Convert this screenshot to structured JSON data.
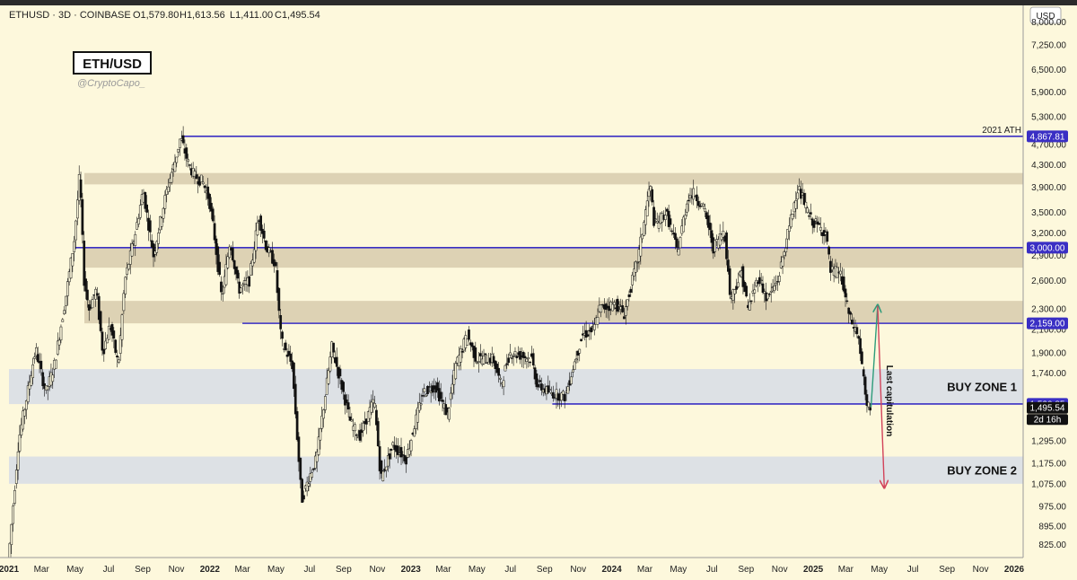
{
  "header": {
    "symbol_line": "ETHUSD · 3D · COINBASE",
    "open": "O1,579.80",
    "high": "H1,613.56",
    "low": "L1,411.00",
    "close": "C1,495.54"
  },
  "chart_title": "ETH/USD",
  "author_handle": "@CryptoCapo_",
  "currency_label": "USD",
  "colors": {
    "background": "#fdf8dc",
    "level_line": "#3a2fc4",
    "resistance_zone": "#ddd2b4",
    "buy_zone": "#dde1e5",
    "candle": "#111111",
    "up_arrow": "#2e9c7a",
    "down_arrow": "#d2435a",
    "price_tag_current": "#111111"
  },
  "chart_data": {
    "type": "candlestick",
    "y_scale": "log",
    "ylim": [
      780,
      8600
    ],
    "y_ticks": [
      "8,000.00",
      "7,250.00",
      "6,500.00",
      "5,900.00",
      "5,300.00",
      "4,700.00",
      "4,300.00",
      "3,900.00",
      "3,500.00",
      "3,200.00",
      "2,900.00",
      "2,600.00",
      "2,300.00",
      "2,100.00",
      "1,900.00",
      "1,740.00",
      "1,295.00",
      "1,175.00",
      "1,075.00",
      "975.00",
      "895.00",
      "825.00"
    ],
    "y_tick_values": [
      8000,
      7250,
      6500,
      5900,
      5300,
      4700,
      4300,
      3900,
      3500,
      3200,
      2900,
      2600,
      2300,
      2100,
      1900,
      1740,
      1295,
      1175,
      1075,
      975,
      895,
      825
    ],
    "x_ticks": [
      {
        "label": "2021",
        "date": "2021-01-01"
      },
      {
        "label": "Mar",
        "date": "2021-03-01"
      },
      {
        "label": "May",
        "date": "2021-05-01"
      },
      {
        "label": "Jul",
        "date": "2021-07-01"
      },
      {
        "label": "Sep",
        "date": "2021-09-01"
      },
      {
        "label": "Nov",
        "date": "2021-11-01"
      },
      {
        "label": "2022",
        "date": "2022-01-01"
      },
      {
        "label": "Mar",
        "date": "2022-03-01"
      },
      {
        "label": "May",
        "date": "2022-05-01"
      },
      {
        "label": "Jul",
        "date": "2022-07-01"
      },
      {
        "label": "Sep",
        "date": "2022-09-01"
      },
      {
        "label": "Nov",
        "date": "2022-11-01"
      },
      {
        "label": "2023",
        "date": "2023-01-01"
      },
      {
        "label": "Mar",
        "date": "2023-03-01"
      },
      {
        "label": "May",
        "date": "2023-05-01"
      },
      {
        "label": "Jul",
        "date": "2023-07-01"
      },
      {
        "label": "Sep",
        "date": "2023-09-01"
      },
      {
        "label": "Nov",
        "date": "2023-11-01"
      },
      {
        "label": "2024",
        "date": "2024-01-01"
      },
      {
        "label": "Mar",
        "date": "2024-03-01"
      },
      {
        "label": "May",
        "date": "2024-05-01"
      },
      {
        "label": "Jul",
        "date": "2024-07-01"
      },
      {
        "label": "Sep",
        "date": "2024-09-01"
      },
      {
        "label": "Nov",
        "date": "2024-11-01"
      },
      {
        "label": "2025",
        "date": "2025-01-01"
      },
      {
        "label": "Mar",
        "date": "2025-03-01"
      },
      {
        "label": "May",
        "date": "2025-05-01"
      },
      {
        "label": "Jul",
        "date": "2025-07-01"
      },
      {
        "label": "Sep",
        "date": "2025-09-01"
      },
      {
        "label": "Nov",
        "date": "2025-11-01"
      },
      {
        "label": "2026",
        "date": "2026-01-01"
      }
    ],
    "xlim": [
      "2021-01-01",
      "2026-01-01"
    ],
    "price_path": [
      [
        "2021-01-01",
        760
      ],
      [
        "2021-01-20",
        1300
      ],
      [
        "2021-02-10",
        1700
      ],
      [
        "2021-02-20",
        1930
      ],
      [
        "2021-03-10",
        1600
      ],
      [
        "2021-03-25",
        1780
      ],
      [
        "2021-04-15",
        2400
      ],
      [
        "2021-05-01",
        3100
      ],
      [
        "2021-05-11",
        4150
      ],
      [
        "2021-05-19",
        2600
      ],
      [
        "2021-05-28",
        2300
      ],
      [
        "2021-06-10",
        2500
      ],
      [
        "2021-06-22",
        1900
      ],
      [
        "2021-07-05",
        2150
      ],
      [
        "2021-07-20",
        1800
      ],
      [
        "2021-08-01",
        2600
      ],
      [
        "2021-08-20",
        3200
      ],
      [
        "2021-09-03",
        3850
      ],
      [
        "2021-09-22",
        2900
      ],
      [
        "2021-10-05",
        3400
      ],
      [
        "2021-10-20",
        4000
      ],
      [
        "2021-11-01",
        4400
      ],
      [
        "2021-11-10",
        4850
      ],
      [
        "2021-11-25",
        4300
      ],
      [
        "2021-12-05",
        4100
      ],
      [
        "2021-12-20",
        4000
      ],
      [
        "2022-01-01",
        3700
      ],
      [
        "2022-01-10",
        3200
      ],
      [
        "2022-01-24",
        2400
      ],
      [
        "2022-02-08",
        3100
      ],
      [
        "2022-02-24",
        2500
      ],
      [
        "2022-03-15",
        2600
      ],
      [
        "2022-04-01",
        3450
      ],
      [
        "2022-04-15",
        3000
      ],
      [
        "2022-05-01",
        2800
      ],
      [
        "2022-05-12",
        2000
      ],
      [
        "2022-06-01",
        1800
      ],
      [
        "2022-06-18",
        1000
      ],
      [
        "2022-07-01",
        1100
      ],
      [
        "2022-07-15",
        1200
      ],
      [
        "2022-08-12",
        1950
      ],
      [
        "2022-09-05",
        1550
      ],
      [
        "2022-09-15",
        1400
      ],
      [
        "2022-10-01",
        1320
      ],
      [
        "2022-10-28",
        1550
      ],
      [
        "2022-11-09",
        1100
      ],
      [
        "2022-12-01",
        1270
      ],
      [
        "2022-12-25",
        1200
      ],
      [
        "2023-01-10",
        1400
      ],
      [
        "2023-01-25",
        1600
      ],
      [
        "2023-02-15",
        1650
      ],
      [
        "2023-03-10",
        1450
      ],
      [
        "2023-03-25",
        1800
      ],
      [
        "2023-04-15",
        2050
      ],
      [
        "2023-05-01",
        1850
      ],
      [
        "2023-06-01",
        1850
      ],
      [
        "2023-06-15",
        1650
      ],
      [
        "2023-07-01",
        1900
      ],
      [
        "2023-07-20",
        1880
      ],
      [
        "2023-08-10",
        1850
      ],
      [
        "2023-08-20",
        1650
      ],
      [
        "2023-09-10",
        1600
      ],
      [
        "2023-10-10",
        1570
      ],
      [
        "2023-10-25",
        1800
      ],
      [
        "2023-11-10",
        2050
      ],
      [
        "2023-12-01",
        2100
      ],
      [
        "2023-12-10",
        2300
      ],
      [
        "2024-01-10",
        2350
      ],
      [
        "2024-01-25",
        2250
      ],
      [
        "2024-02-20",
        2900
      ],
      [
        "2024-03-12",
        3950
      ],
      [
        "2024-03-20",
        3300
      ],
      [
        "2024-04-10",
        3500
      ],
      [
        "2024-05-01",
        2950
      ],
      [
        "2024-05-20",
        3750
      ],
      [
        "2024-06-01",
        3800
      ],
      [
        "2024-06-20",
        3500
      ],
      [
        "2024-07-05",
        3000
      ],
      [
        "2024-07-25",
        3250
      ],
      [
        "2024-08-05",
        2400
      ],
      [
        "2024-08-25",
        2700
      ],
      [
        "2024-09-06",
        2300
      ],
      [
        "2024-09-25",
        2650
      ],
      [
        "2024-10-10",
        2400
      ],
      [
        "2024-10-30",
        2600
      ],
      [
        "2024-11-15",
        3100
      ],
      [
        "2024-12-05",
        3900
      ],
      [
        "2024-12-15",
        3700
      ],
      [
        "2024-12-28",
        3400
      ],
      [
        "2025-01-10",
        3300
      ],
      [
        "2025-01-25",
        3200
      ],
      [
        "2025-02-03",
        2700
      ],
      [
        "2025-02-20",
        2700
      ],
      [
        "2025-03-10",
        2200
      ],
      [
        "2025-03-25",
        2050
      ],
      [
        "2025-04-01",
        1800
      ],
      [
        "2025-04-09",
        1500
      ],
      [
        "2025-04-15",
        1495
      ]
    ],
    "horizontal_levels": [
      {
        "price": 4867.81,
        "label": "4,867.81",
        "start": "2021-11-10",
        "note": "2021 ATH"
      },
      {
        "price": 3000.0,
        "label": "3,000.00",
        "start": "2021-05-01"
      },
      {
        "price": 2159.0,
        "label": "2,159.00",
        "start": "2022-03-01"
      },
      {
        "price": 1520.85,
        "label": "1,520.85",
        "start": "2023-09-15"
      }
    ],
    "resistance_zones": [
      {
        "low": 3950,
        "high": 4150
      },
      {
        "low": 2750,
        "high": 3000
      },
      {
        "low": 2159,
        "high": 2380
      }
    ],
    "buy_zones": [
      {
        "low": 1520,
        "high": 1770,
        "label": "BUY ZONE 1"
      },
      {
        "low": 1075,
        "high": 1210,
        "label": "BUY ZONE 2"
      }
    ],
    "current_price": {
      "value": 1495.54,
      "label": "1,495.54",
      "countdown": "2d 16h"
    },
    "arrows": [
      {
        "from_date": "2025-04-16",
        "from_price": 1500,
        "to_date": "2025-04-28",
        "to_price": 2330,
        "color": "up"
      },
      {
        "from_date": "2025-04-28",
        "from_price": 2330,
        "to_date": "2025-05-10",
        "to_price": 1060,
        "color": "down"
      }
    ],
    "arrow_label": "Last capitulation"
  }
}
